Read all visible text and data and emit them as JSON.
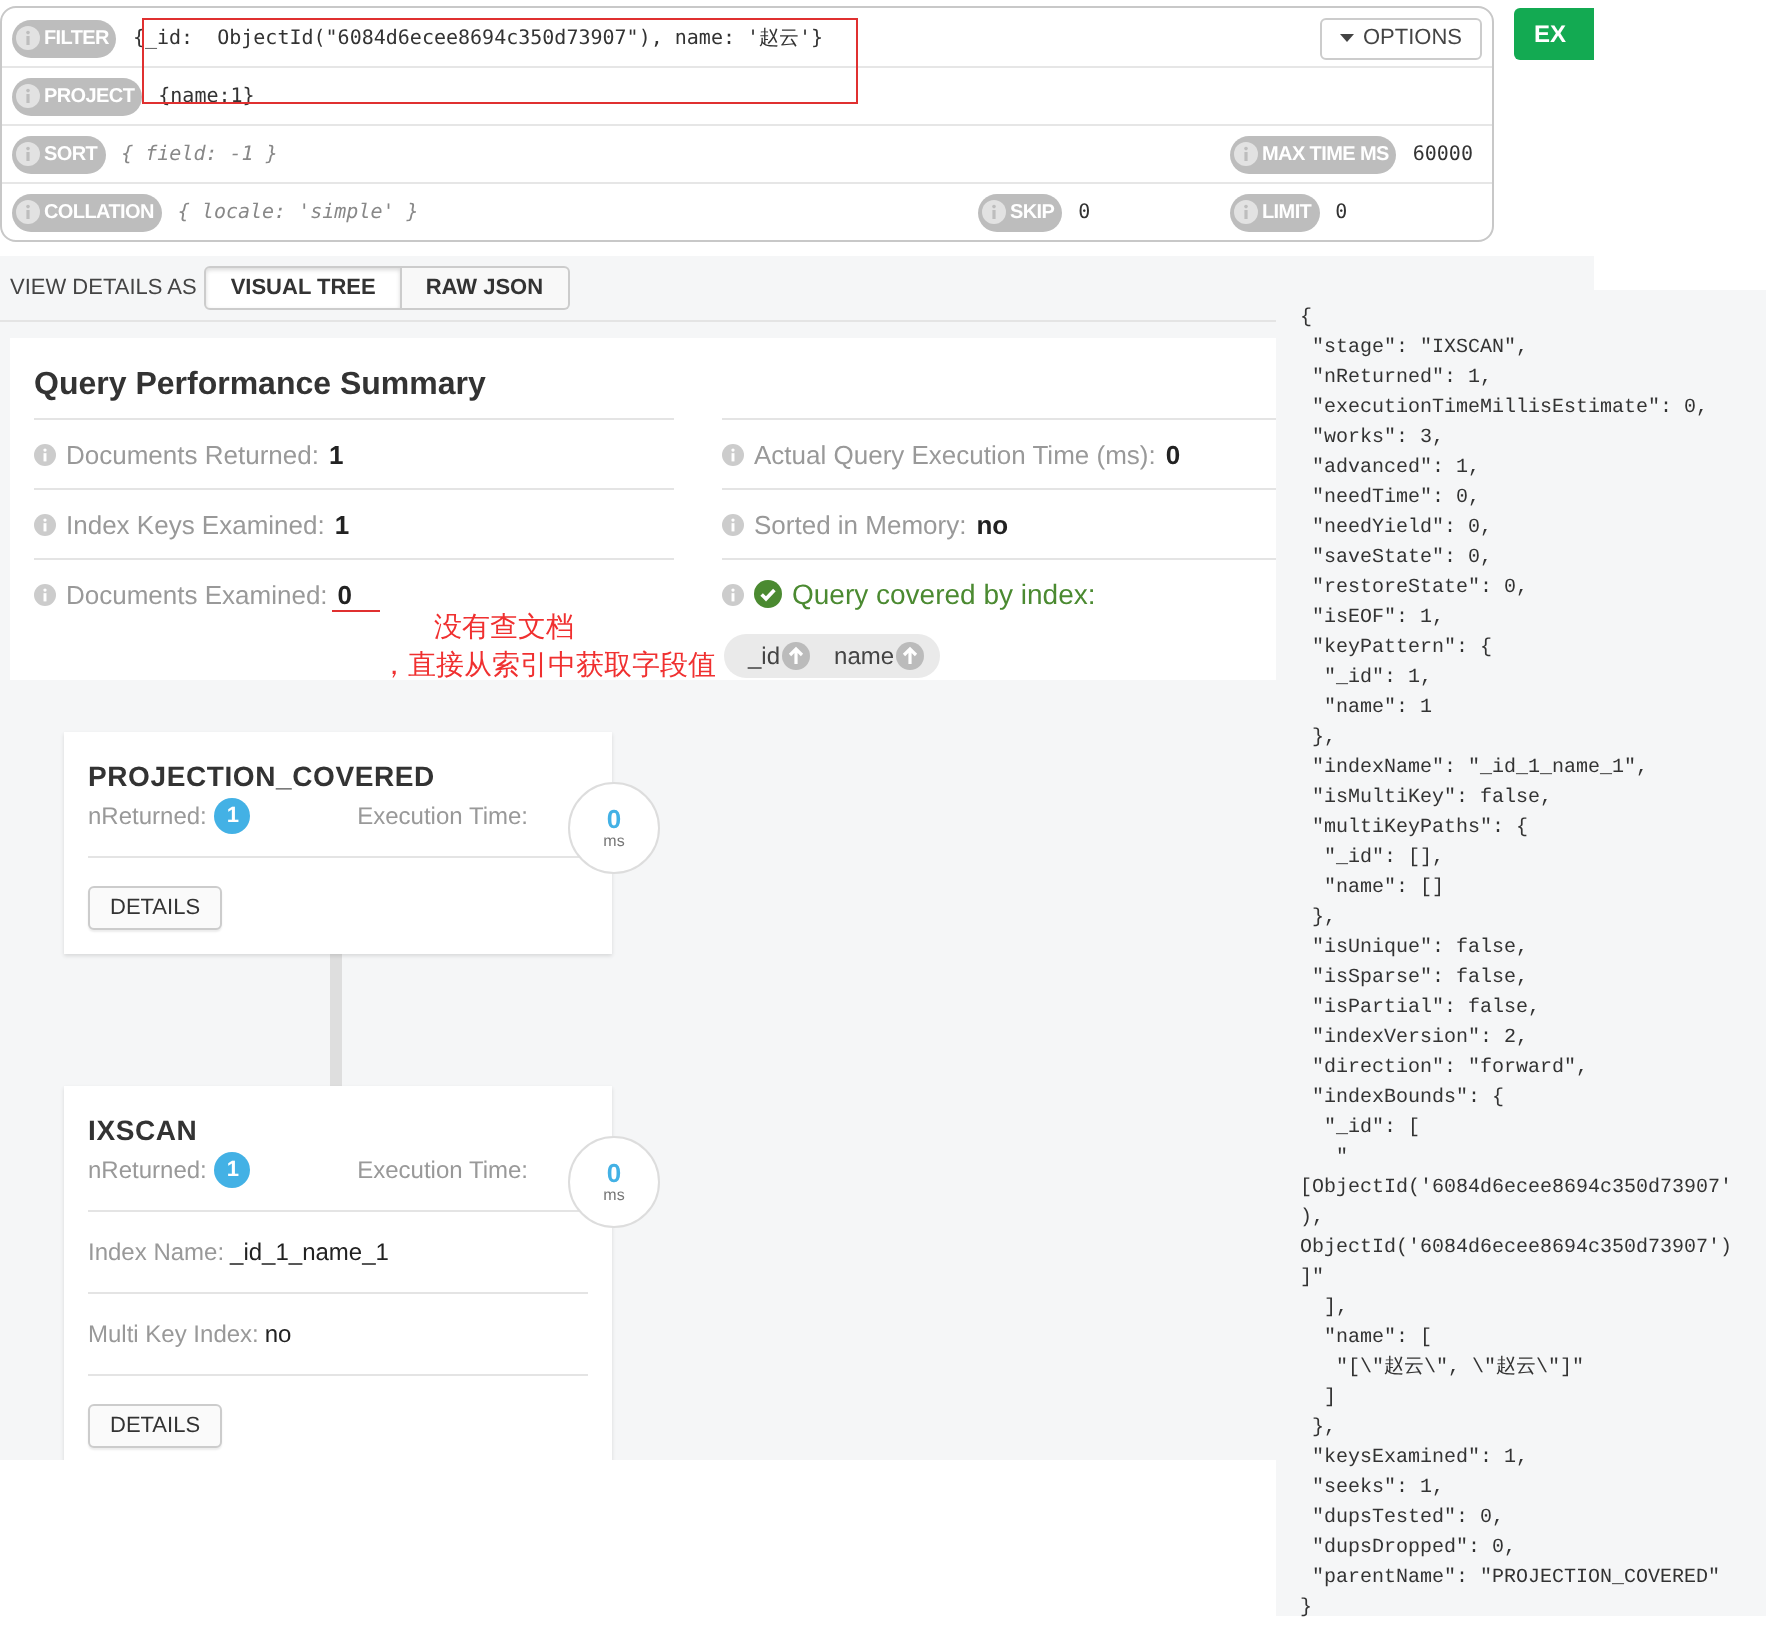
{
  "query_bar": {
    "rows": [
      {
        "items": [
          {
            "label": "FILTER",
            "value": "{_id:  ObjectId(\"6084d6ecee8694c350d73907\"), name: '赵云'}"
          }
        ],
        "options_button": "OPTIONS"
      },
      {
        "items": [
          {
            "label": "PROJECT",
            "value": "{name:1}"
          }
        ]
      },
      {
        "items": [
          {
            "label": "SORT",
            "placeholder": "{ field: -1 }"
          },
          {
            "label": "MAX TIME MS",
            "value": "60000"
          }
        ]
      },
      {
        "items": [
          {
            "label": "COLLATION",
            "placeholder": "{ locale: 'simple' }"
          },
          {
            "label": "SKIP",
            "value": "0"
          },
          {
            "label": "LIMIT",
            "value": "0"
          }
        ]
      }
    ],
    "execute_button": "EX"
  },
  "view_details": {
    "label": "VIEW DETAILS AS",
    "tabs": [
      {
        "label": "VISUAL TREE",
        "selected": true
      },
      {
        "label": "RAW JSON",
        "selected": false
      }
    ]
  },
  "summary": {
    "title": "Query Performance Summary",
    "left": [
      {
        "label": "Documents Returned:",
        "value": "1"
      },
      {
        "label": "Index Keys Examined:",
        "value": "1"
      },
      {
        "label": "Documents Examined:",
        "value": "0"
      }
    ],
    "right": [
      {
        "label": "Actual Query Execution Time (ms):",
        "value": "0"
      },
      {
        "label": "Sorted in Memory:",
        "value": "no"
      }
    ],
    "covered": {
      "label": "Query covered by index:",
      "keys": [
        "_id",
        "name"
      ]
    }
  },
  "annotations": [
    "没有查文档",
    "，直接从索引中获取字段值"
  ],
  "stages": [
    {
      "name": "PROJECTION_COVERED",
      "nreturned_label": "nReturned:",
      "nreturned": "1",
      "exec_label": "Execution Time:",
      "exec_value": "0",
      "exec_unit": "ms",
      "button": "DETAILS"
    },
    {
      "name": "IXSCAN",
      "nreturned_label": "nReturned:",
      "nreturned": "1",
      "exec_label": "Execution Time:",
      "exec_value": "0",
      "exec_unit": "ms",
      "details": [
        {
          "label": "Index Name:",
          "value": "_id_1_name_1"
        },
        {
          "label": "Multi Key Index:",
          "value": "no"
        }
      ],
      "button": "DETAILS"
    }
  ],
  "raw_json": [
    "{",
    " \"stage\": \"IXSCAN\",",
    " \"nReturned\": 1,",
    " \"executionTimeMillisEstimate\": 0,",
    " \"works\": 3,",
    " \"advanced\": 1,",
    " \"needTime\": 0,",
    " \"needYield\": 0,",
    " \"saveState\": 0,",
    " \"restoreState\": 0,",
    " \"isEOF\": 1,",
    " \"keyPattern\": {",
    "  \"_id\": 1,",
    "  \"name\": 1",
    " },",
    " \"indexName\": \"_id_1_name_1\",",
    " \"isMultiKey\": false,",
    " \"multiKeyPaths\": {",
    "  \"_id\": [],",
    "  \"name\": []",
    " },",
    " \"isUnique\": false,",
    " \"isSparse\": false,",
    " \"isPartial\": false,",
    " \"indexVersion\": 2,",
    " \"direction\": \"forward\",",
    " \"indexBounds\": {",
    "  \"_id\": [",
    "   \"",
    "[ObjectId('6084d6ecee8694c350d73907'",
    "),",
    "ObjectId('6084d6ecee8694c350d73907')",
    "]\"",
    "  ],",
    "  \"name\": [",
    "   \"[\\\"赵云\\\", \\\"赵云\\\"]\"",
    "  ]",
    " },",
    " \"keysExamined\": 1,",
    " \"seeks\": 1,",
    " \"dupsTested\": 0,",
    " \"dupsDropped\": 0,",
    " \"parentName\": \"PROJECTION_COVERED\"",
    "}"
  ]
}
